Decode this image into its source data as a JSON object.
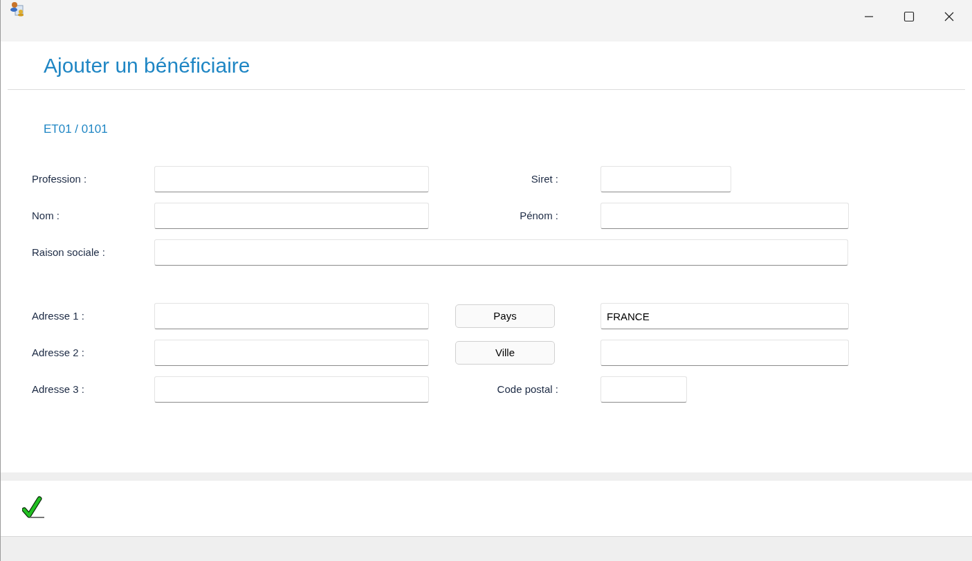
{
  "heading": "Ajouter un bénéficiaire",
  "code": "ET01 / 0101",
  "groups": [
    {
      "rows": [
        {
          "label": "Profession :",
          "right": {
            "kind": "label",
            "text": "Siret :"
          }
        },
        {
          "label": "Nom :",
          "right": {
            "kind": "label",
            "text": "Pénom :"
          }
        },
        {
          "label": "Raison sociale :"
        }
      ]
    },
    {
      "rows": [
        {
          "label": "Adresse 1 :",
          "right": {
            "kind": "button",
            "text": "Pays"
          },
          "right_value": "FRANCE"
        },
        {
          "label": "Adresse 2 :",
          "right": {
            "kind": "button",
            "text": "Ville"
          }
        },
        {
          "label": "Adresse 3 :",
          "right": {
            "kind": "label",
            "text": "Code postal :"
          }
        }
      ]
    }
  ]
}
